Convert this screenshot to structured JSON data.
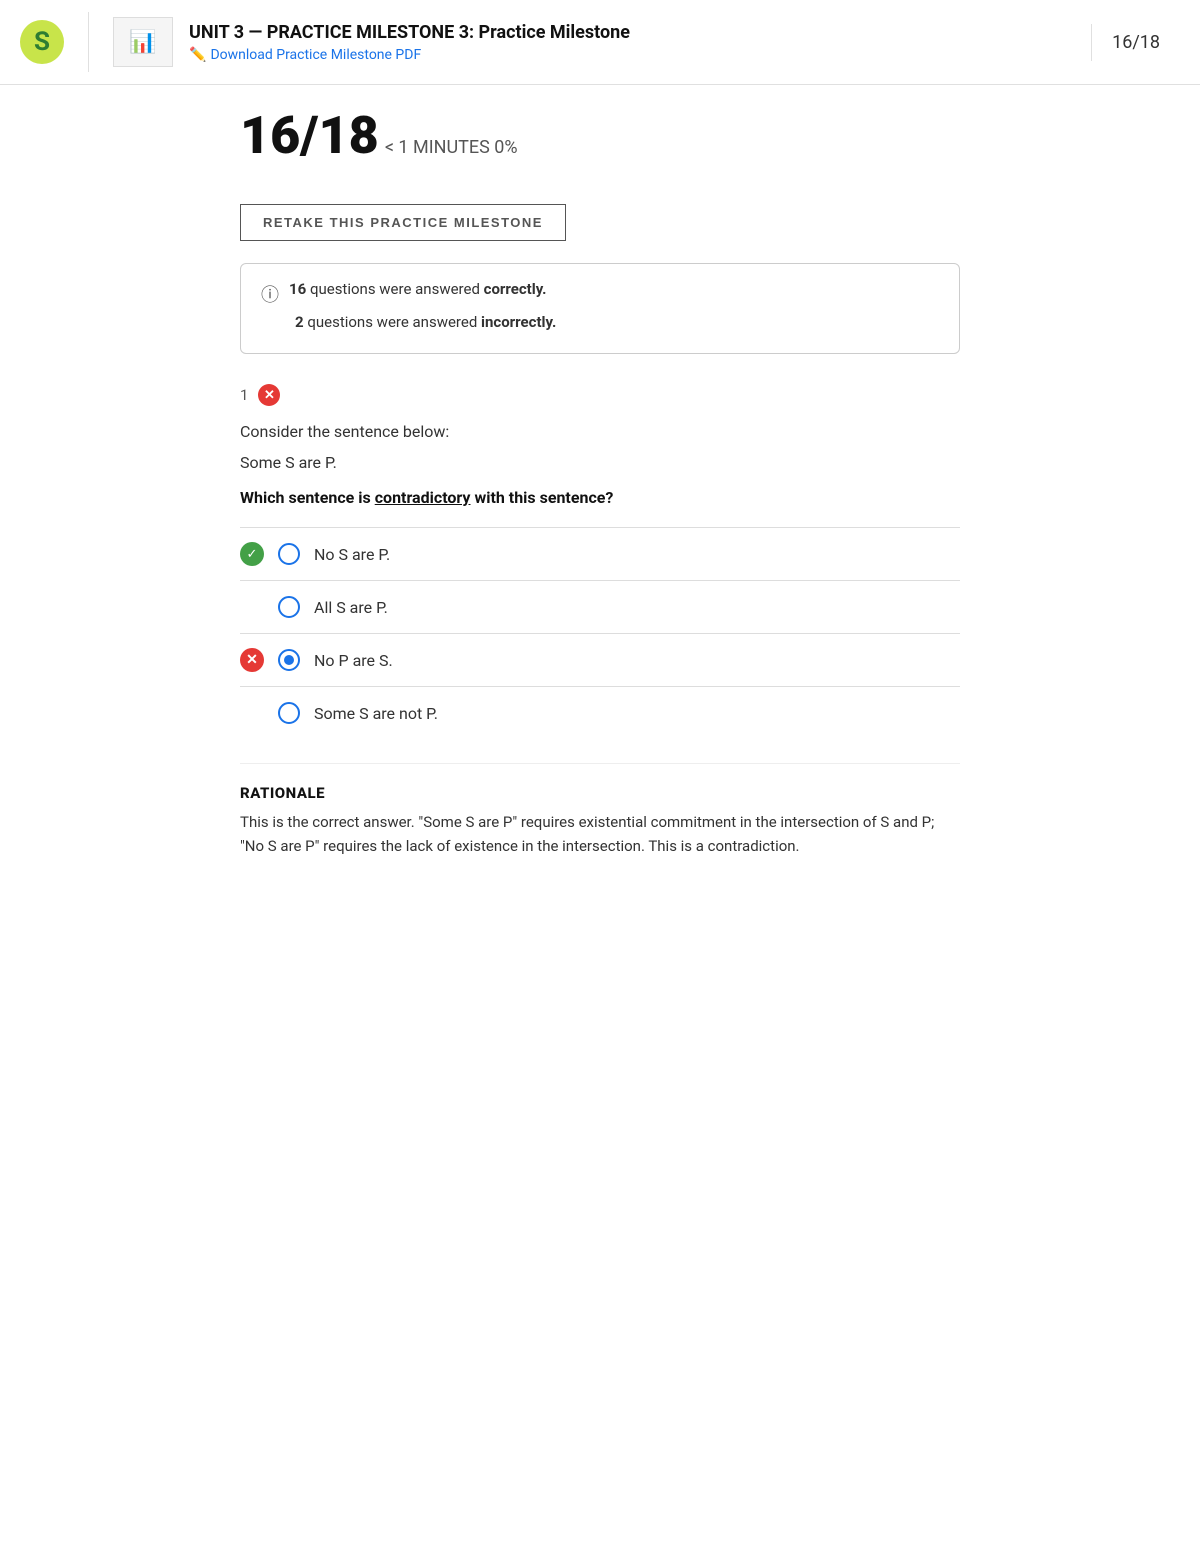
{
  "header": {
    "unit_title": "UNIT 3 — PRACTICE MILESTONE 3: Practice Milestone",
    "download_label": "Download Practice Milestone PDF",
    "score_display": "16/18",
    "thumbnail_icon": "📊"
  },
  "score_area": {
    "score_big": "16/18",
    "score_sub": "< 1 MINUTES 0%"
  },
  "retake_button": {
    "label": "RETAKE THIS PRACTICE MILESTONE"
  },
  "summary_box": {
    "correct_count": "16",
    "correct_text": " questions were answered ",
    "correct_bold": "correctly.",
    "incorrect_count": "2",
    "incorrect_text": " questions were answered ",
    "incorrect_bold": "incorrectly."
  },
  "question": {
    "number": "1",
    "prompt": "Consider the sentence below:",
    "sentence": "Some S are P.",
    "ask_prefix": "Which sentence is ",
    "ask_underline": "contradictory",
    "ask_suffix": " with this sentence?",
    "options": [
      {
        "id": "a",
        "label": "No S are P.",
        "correct_answer": true,
        "user_selected": false,
        "show_check": true,
        "show_x": false
      },
      {
        "id": "b",
        "label": "All S are P.",
        "correct_answer": false,
        "user_selected": false,
        "show_check": false,
        "show_x": false
      },
      {
        "id": "c",
        "label": "No P are S.",
        "correct_answer": false,
        "user_selected": true,
        "show_check": false,
        "show_x": true
      },
      {
        "id": "d",
        "label": "Some S are not P.",
        "correct_answer": false,
        "user_selected": false,
        "show_check": false,
        "show_x": false
      }
    ],
    "rationale_title": "RATIONALE",
    "rationale_text": "This is the correct answer. \"Some S are P\" requires existential commitment in the intersection of S and P; \"No S are P\" requires the lack of existence in the intersection. This is a contradiction."
  }
}
